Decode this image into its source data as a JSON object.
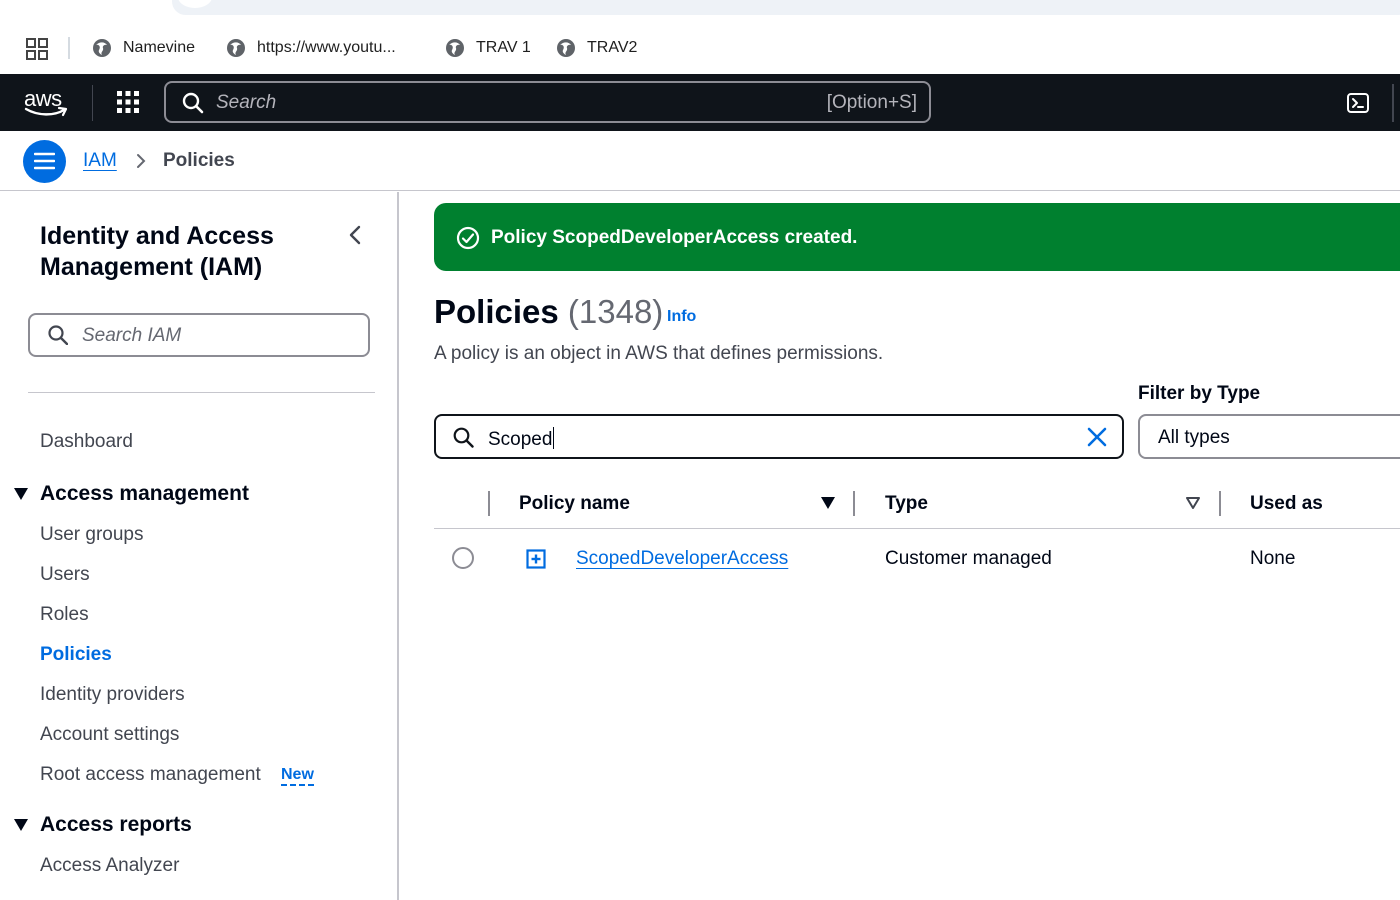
{
  "browser": {
    "bookmarks": [
      {
        "label": "Namevine",
        "icon": "globe-icon"
      },
      {
        "label": "https://www.youtu...",
        "icon": "globe-icon"
      },
      {
        "label": "TRAV 1",
        "icon": "globe-icon"
      },
      {
        "label": "TRAV2",
        "icon": "globe-icon"
      }
    ]
  },
  "topnav": {
    "logo_text": "aws",
    "search_placeholder": "Search",
    "search_shortcut": "[Option+S]"
  },
  "breadcrumb": {
    "items": [
      "IAM",
      "Policies"
    ]
  },
  "sidebar": {
    "title": "Identity and Access Management (IAM)",
    "search_placeholder": "Search IAM",
    "dashboard": "Dashboard",
    "sections": [
      {
        "label": "Access management",
        "items": [
          "User groups",
          "Users",
          "Roles",
          "Policies",
          "Identity providers",
          "Account settings",
          "Root access management"
        ],
        "active": "Policies",
        "new_badge": "New"
      },
      {
        "label": "Access reports",
        "items": [
          "Access Analyzer"
        ]
      }
    ]
  },
  "flash": {
    "message": "Policy ScopedDeveloperAccess created.",
    "color": "#00802f"
  },
  "main": {
    "title": "Policies",
    "count": "(1348)",
    "info_label": "Info",
    "description": "A policy is an object in AWS that defines permissions.",
    "search_value": "Scoped",
    "filter_label": "Filter by Type",
    "filter_value": "All types"
  },
  "table": {
    "columns": [
      "Policy name",
      "Type",
      "Used as"
    ],
    "rows": [
      {
        "policy_name": "ScopedDeveloperAccess",
        "type": "Customer managed",
        "used_as": "None"
      }
    ]
  },
  "colors": {
    "accent": "#006ce0",
    "nav_bg": "#0f141a",
    "success": "#00802f"
  }
}
